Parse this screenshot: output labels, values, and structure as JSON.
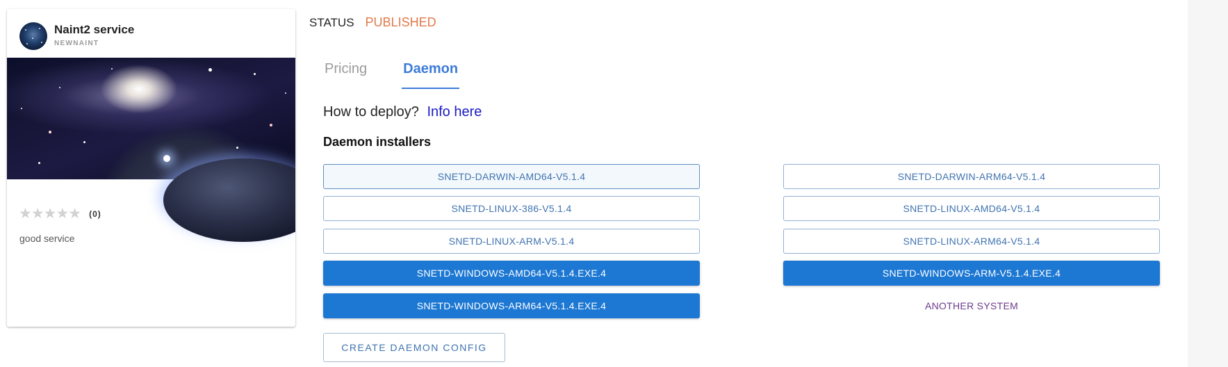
{
  "card": {
    "title": "Naint2 service",
    "subtitle": "NEWNAINT",
    "rating_stars": "★★★★★",
    "rating_count": "(0)",
    "rating_value": 0,
    "description": "good service"
  },
  "status": {
    "label": "STATUS",
    "value": "PUBLISHED"
  },
  "tabs": [
    {
      "label": "Pricing",
      "active": false
    },
    {
      "label": "Daemon",
      "active": true
    }
  ],
  "deploy": {
    "question": "How to deploy?",
    "link": "Info here"
  },
  "installers": {
    "title": "Daemon installers",
    "buttons": [
      "SNETD-DARWIN-AMD64-V5.1.4",
      "SNETD-DARWIN-ARM64-V5.1.4",
      "SNETD-LINUX-386-V5.1.4",
      "SNETD-LINUX-AMD64-V5.1.4",
      "SNETD-LINUX-ARM-V5.1.4",
      "SNETD-LINUX-ARM64-V5.1.4",
      "SNETD-WINDOWS-AMD64-V5.1.4.EXE.4",
      "SNETD-WINDOWS-ARM-V5.1.4.EXE.4",
      "SNETD-WINDOWS-ARM64-V5.1.4.EXE.4",
      "ANOTHER SYSTEM"
    ]
  },
  "create_config_label": "CREATE DAEMON CONFIG",
  "colors": {
    "accent": "#1d78d3",
    "status_published": "#e07a4a",
    "tab_active": "#3d7bd8",
    "link": "#1a1ac4"
  }
}
